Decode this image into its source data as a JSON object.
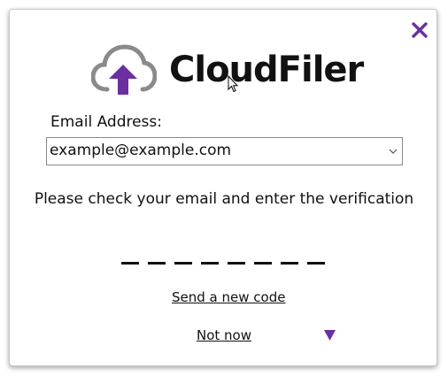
{
  "dialog": {
    "logo_text": "CloudFiler",
    "email_label": "Email Address:",
    "email_value": "example@example.com",
    "instruction": "Please check your email and enter the verification",
    "code_slots": 8,
    "send_new_code_label": "Send a new code",
    "not_now_label": "Not now"
  },
  "icons": {
    "close": "close-icon",
    "logo": "cloud-upload-icon",
    "select_chevron": "chevron-down-icon",
    "more": "triangle-down-icon"
  },
  "colors": {
    "accent": "#6b2fa0",
    "cloud_gray": "#8a8a8a",
    "text": "#111111"
  }
}
